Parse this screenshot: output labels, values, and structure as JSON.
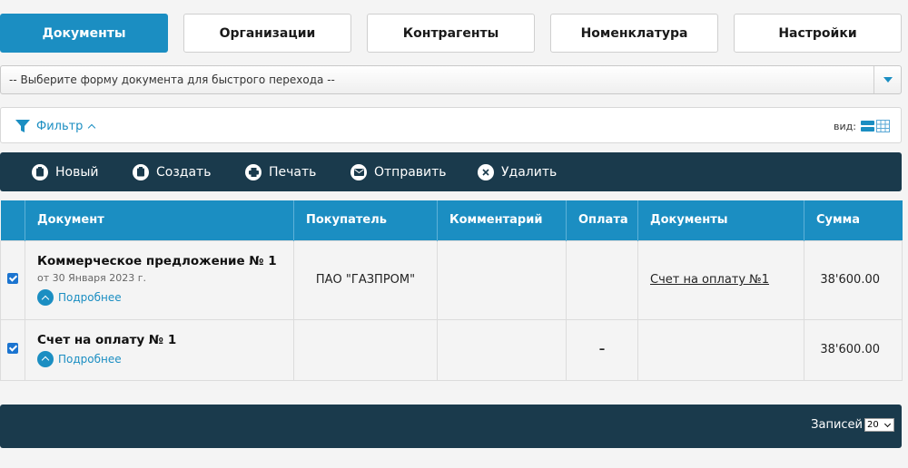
{
  "tabs": [
    {
      "label": "Документы",
      "active": true
    },
    {
      "label": "Организации",
      "active": false
    },
    {
      "label": "Контрагенты",
      "active": false
    },
    {
      "label": "Номенклатура",
      "active": false
    },
    {
      "label": "Настройки",
      "active": false
    }
  ],
  "form_select": {
    "placeholder": "-- Выберите форму документа для быстрого перехода --"
  },
  "filter": {
    "label": "Фильтр",
    "view_label": "вид:"
  },
  "toolbar": {
    "new_label": "Новый",
    "create_label": "Создать",
    "print_label": "Печать",
    "send_label": "Отправить",
    "delete_label": "Удалить"
  },
  "table": {
    "columns": [
      "Документ",
      "Покупатель",
      "Комментарий",
      "Оплата",
      "Документы",
      "Сумма"
    ],
    "rows": [
      {
        "checked": true,
        "title": "Коммерческое предложение № 1",
        "date": "от 30 Января 2023 г.",
        "more": "Подробнее",
        "buyer": "ПАО \"ГАЗПРОМ\"",
        "comment": "",
        "payment": "",
        "documents": "Счет на оплату №1",
        "sum": "38'600.00"
      },
      {
        "checked": true,
        "title": "Счет на оплату № 1",
        "date": "",
        "more": "Подробнее",
        "buyer": "",
        "comment": "",
        "payment": "–",
        "documents": "",
        "sum": "38'600.00"
      }
    ]
  },
  "footer": {
    "records_label": "Записей",
    "records_value": "20"
  },
  "colors": {
    "accent": "#1b8ec2",
    "dark": "#1a3a4c"
  }
}
